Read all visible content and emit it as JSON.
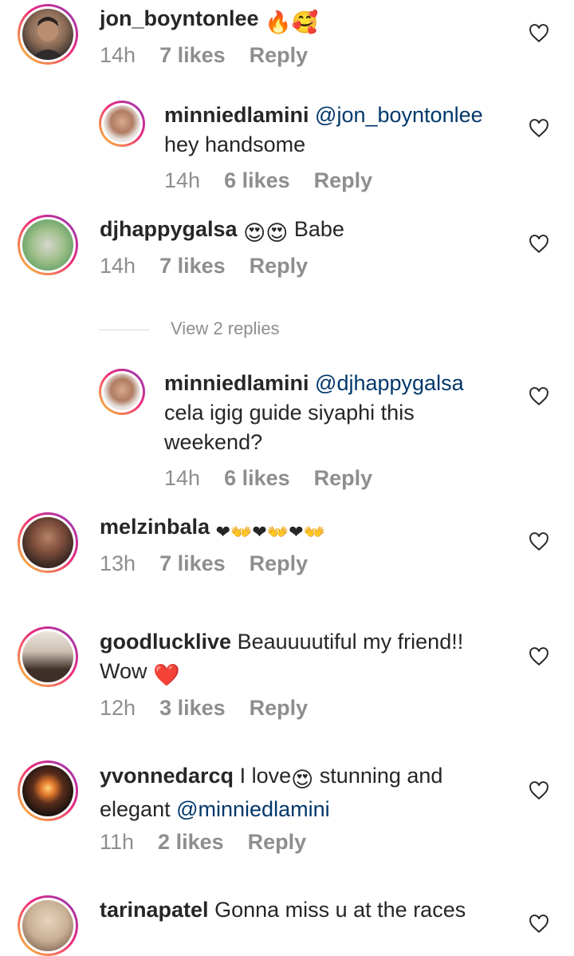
{
  "comments": [
    {
      "username": "jon_boyntonlee",
      "mention": "",
      "body": "",
      "time": "14h",
      "likes": "7 likes",
      "reply": "Reply",
      "emojis": "🔥🥰"
    },
    {
      "username": "minniedlamini",
      "mention": "@jon_boyntonlee",
      "body": "hey handsome",
      "time": "14h",
      "likes": "6 likes",
      "reply": "Reply"
    },
    {
      "username": "djhappygalsa",
      "mention": "",
      "body": "Babe",
      "time": "14h",
      "likes": "7 likes",
      "reply": "Reply",
      "emojis": "😍😍"
    },
    {
      "username": "minniedlamini",
      "mention": "@djhappygalsa",
      "body_line1": "cela igig guide siyaphi this",
      "body_line2": "weekend?",
      "time": "14h",
      "likes": "6 likes",
      "reply": "Reply"
    },
    {
      "username": "melzinbala",
      "mention": "",
      "body": "",
      "time": "13h",
      "likes": "7 likes",
      "reply": "Reply",
      "emojis": "❤👐❤👐❤👐"
    },
    {
      "username": "goodlucklive",
      "body_line1": "Beauuuutiful my friend!!",
      "body_line2": "Wow",
      "time": "12h",
      "likes": "3 likes",
      "reply": "Reply",
      "emojis": "❤️"
    },
    {
      "username": "yvonnedarcq",
      "body_line1a": "I love",
      "body_line1b": "stunning and",
      "body_line2": "elegant",
      "mention": "@minniedlamini",
      "time": "11h",
      "likes": "2 likes",
      "reply": "Reply",
      "emojis": "😍"
    },
    {
      "username": "tarinapatel",
      "body": "Gonna miss u at the races"
    }
  ],
  "view_replies": "View 2 replies",
  "icons": {
    "like": "heart-outline-icon"
  },
  "colors": {
    "mention": "#00376b",
    "meta": "#8e8e8e",
    "text": "#262626"
  }
}
